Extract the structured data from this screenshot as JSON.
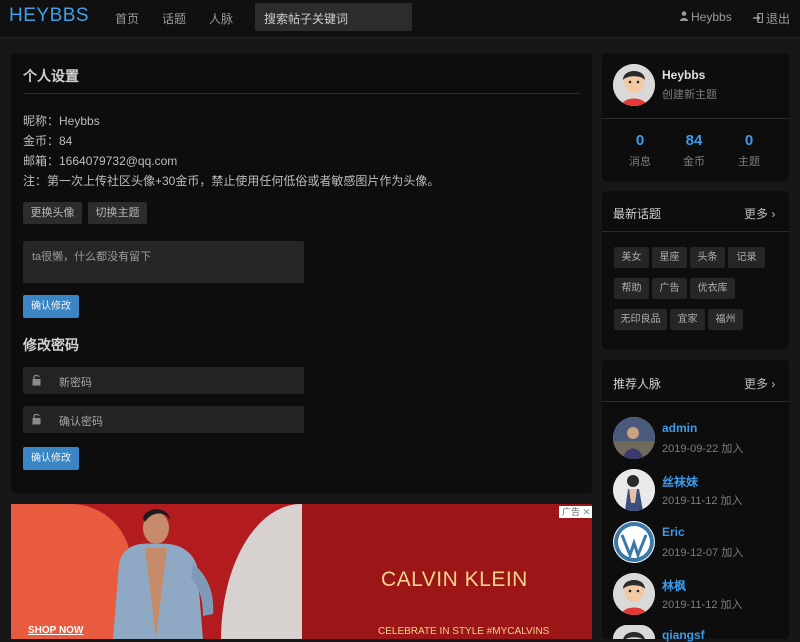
{
  "navbar": {
    "brand": "HEYBBS",
    "links": [
      "首页",
      "话题",
      "人脉"
    ],
    "search_placeholder": "搜索帖子关键词",
    "user": "Heybbs",
    "logout": "退出"
  },
  "settings": {
    "title": "个人设置",
    "nickname": "昵称：Heybbs",
    "coins": "金币：84",
    "email": "邮箱：1664079732@qq.com",
    "note": "注：第一次上传社区头像+30金币，禁止使用任何低俗或者敏感图片作为头像。",
    "change_avatar": "更换头像",
    "switch_theme": "切换主题",
    "bio_placeholder": "ta很懒，什么都没有留下",
    "confirm": "确认修改"
  },
  "password": {
    "title": "修改密码",
    "new_placeholder": "新密码",
    "confirm_placeholder": "确认密码",
    "confirm": "确认修改"
  },
  "ad": {
    "shop_now": "SHOP NOW",
    "brand": "CALVIN KLEIN",
    "slogan": "CELEBRATE IN STYLE #MYCALVINS",
    "tag": "广告",
    "close": "✕"
  },
  "profile": {
    "name": "Heybbs",
    "create_topic": "创建新主题",
    "stats": [
      {
        "value": "0",
        "label": "消息"
      },
      {
        "value": "84",
        "label": "金币"
      },
      {
        "value": "0",
        "label": "主题"
      }
    ]
  },
  "topics": {
    "title": "最新话题",
    "more": "更多",
    "tags": [
      "美女",
      "星座",
      "头条",
      "记录",
      "帮助",
      "广告",
      "优衣库",
      "无印良品",
      "宜家",
      "福州"
    ]
  },
  "people": {
    "title": "推荐人脉",
    "more": "更多",
    "list": [
      {
        "name": "admin",
        "date": "2019-09-22 加入",
        "avatar": "photo-avatar"
      },
      {
        "name": "丝袜妹",
        "date": "2019-11-12 加入",
        "avatar": "photo-avatar"
      },
      {
        "name": "Eric",
        "date": "2019-12-07 加入",
        "avatar": "wordpress-icon"
      },
      {
        "name": "林枫",
        "date": "2019-11-12 加入",
        "avatar": "default-avatar"
      },
      {
        "name": "qiangsf",
        "date": "",
        "avatar": "default-avatar"
      }
    ]
  },
  "colors": {
    "accent": "#3d9ae8",
    "button": "#3a86c4",
    "background": "#171717",
    "panel": "#0d0d0d"
  }
}
